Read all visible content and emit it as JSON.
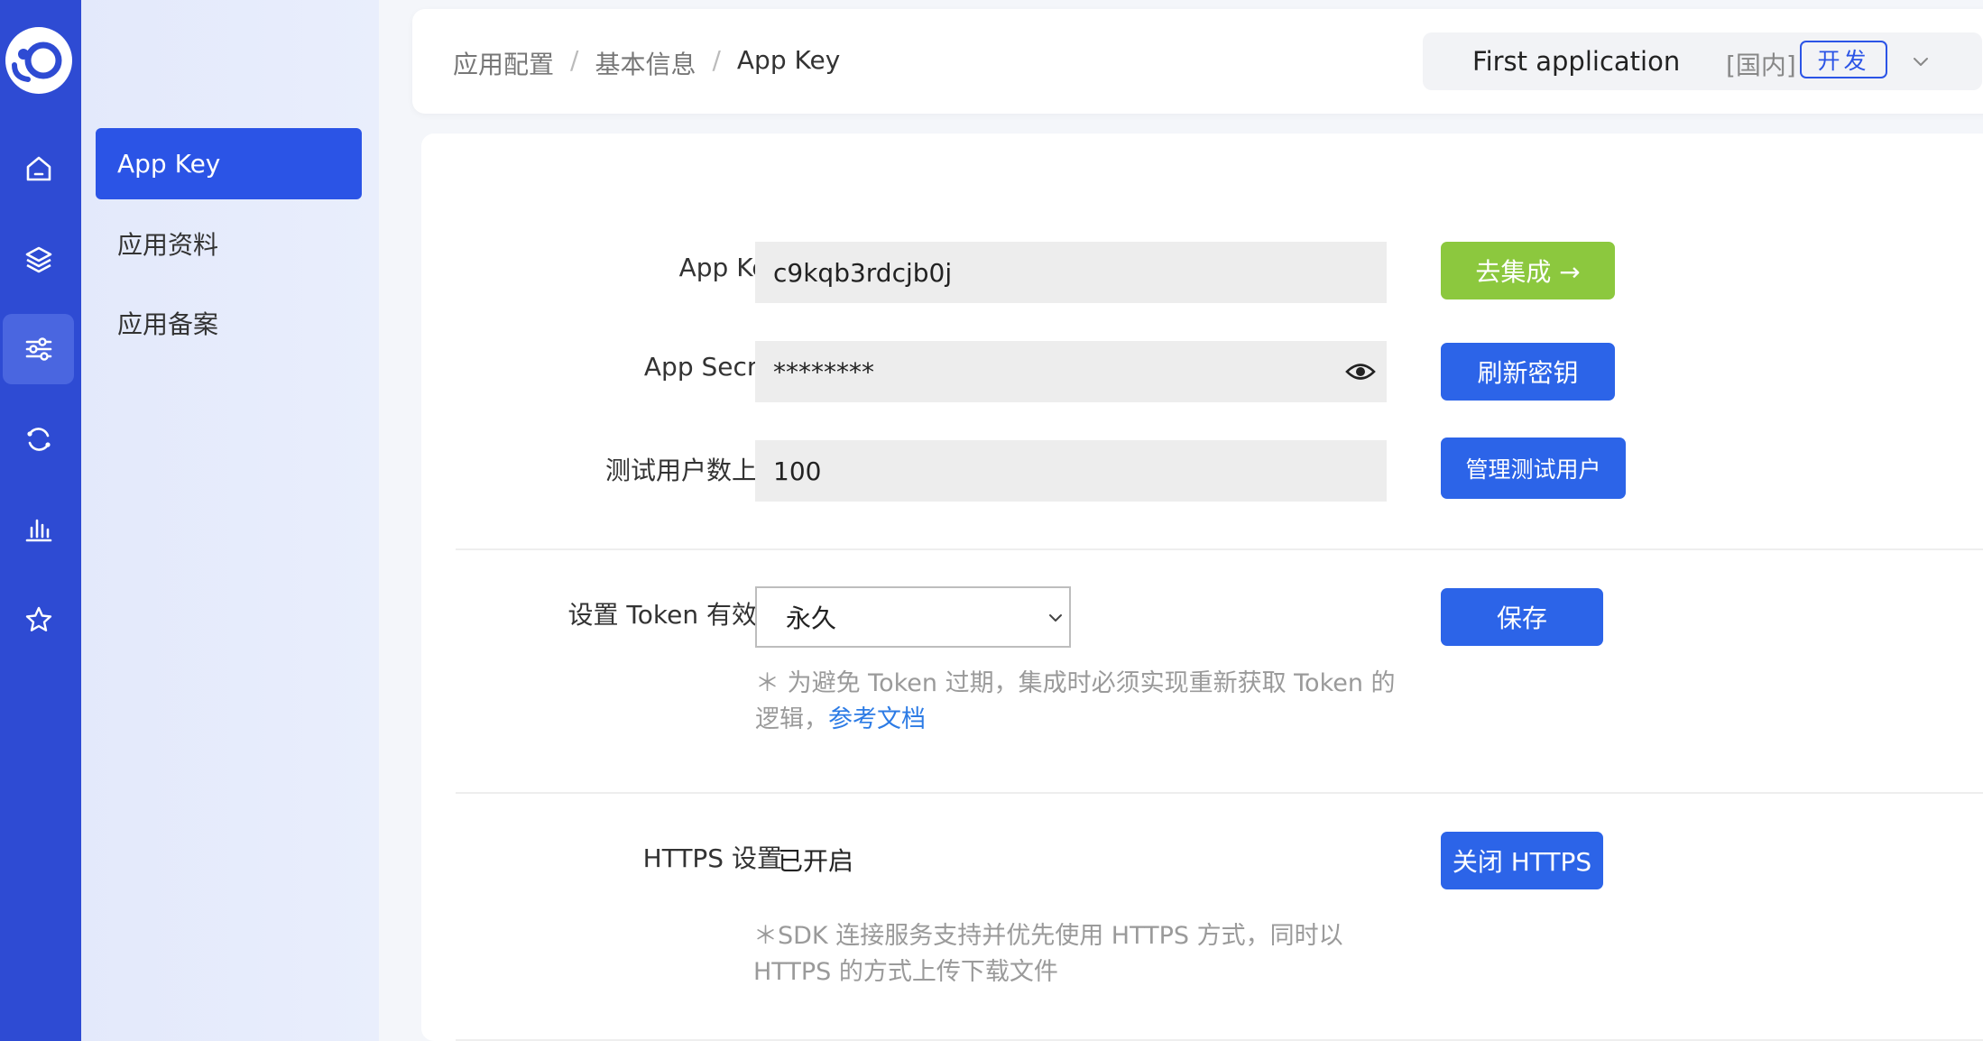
{
  "rail": {
    "items": [
      {
        "icon": "home-icon",
        "active": false
      },
      {
        "icon": "layers-icon",
        "active": false
      },
      {
        "icon": "sliders-icon",
        "active": true
      },
      {
        "icon": "sync-icon",
        "active": false
      },
      {
        "icon": "bar-chart-icon",
        "active": false
      },
      {
        "icon": "star-icon",
        "active": false
      }
    ]
  },
  "submenu": {
    "items": [
      {
        "label": "App Key",
        "active": true
      },
      {
        "label": "应用资料",
        "active": false
      },
      {
        "label": "应用备案",
        "active": false
      }
    ]
  },
  "header": {
    "breadcrumb": [
      "应用配置",
      "基本信息",
      "App Key"
    ],
    "separator": "/",
    "app_name": "First application",
    "region": "[国内]",
    "env": "开发"
  },
  "form": {
    "app_key": {
      "label": "App Key",
      "value": "c9kqb3rdcjb0j",
      "button": "去集成 →"
    },
    "app_secret": {
      "label": "App Secret",
      "value": "********",
      "button": "刷新密钥"
    },
    "test_users": {
      "label": "测试用户数上限",
      "value": "100",
      "button": "管理测试用户"
    },
    "token": {
      "label": "设置 Token 有效期",
      "selected": "永久",
      "button": "保存",
      "hint_prefix": "＊ 为避免 Token 过期，集成时必须实现重新获取 Token 的",
      "hint_line2": "逻辑，",
      "hint_link": "参考文档"
    },
    "https": {
      "label": "HTTPS 设置",
      "status": "已开启",
      "button": "关闭 HTTPS",
      "hint_line1": "＊SDK 连接服务支持并优先使用 HTTPS 方式，同时以",
      "hint_line2": "HTTPS 的方式上传下载文件"
    }
  },
  "colors": {
    "rail": "#2e4bd3",
    "primary": "#2b54e6",
    "green": "#8cc83e"
  }
}
